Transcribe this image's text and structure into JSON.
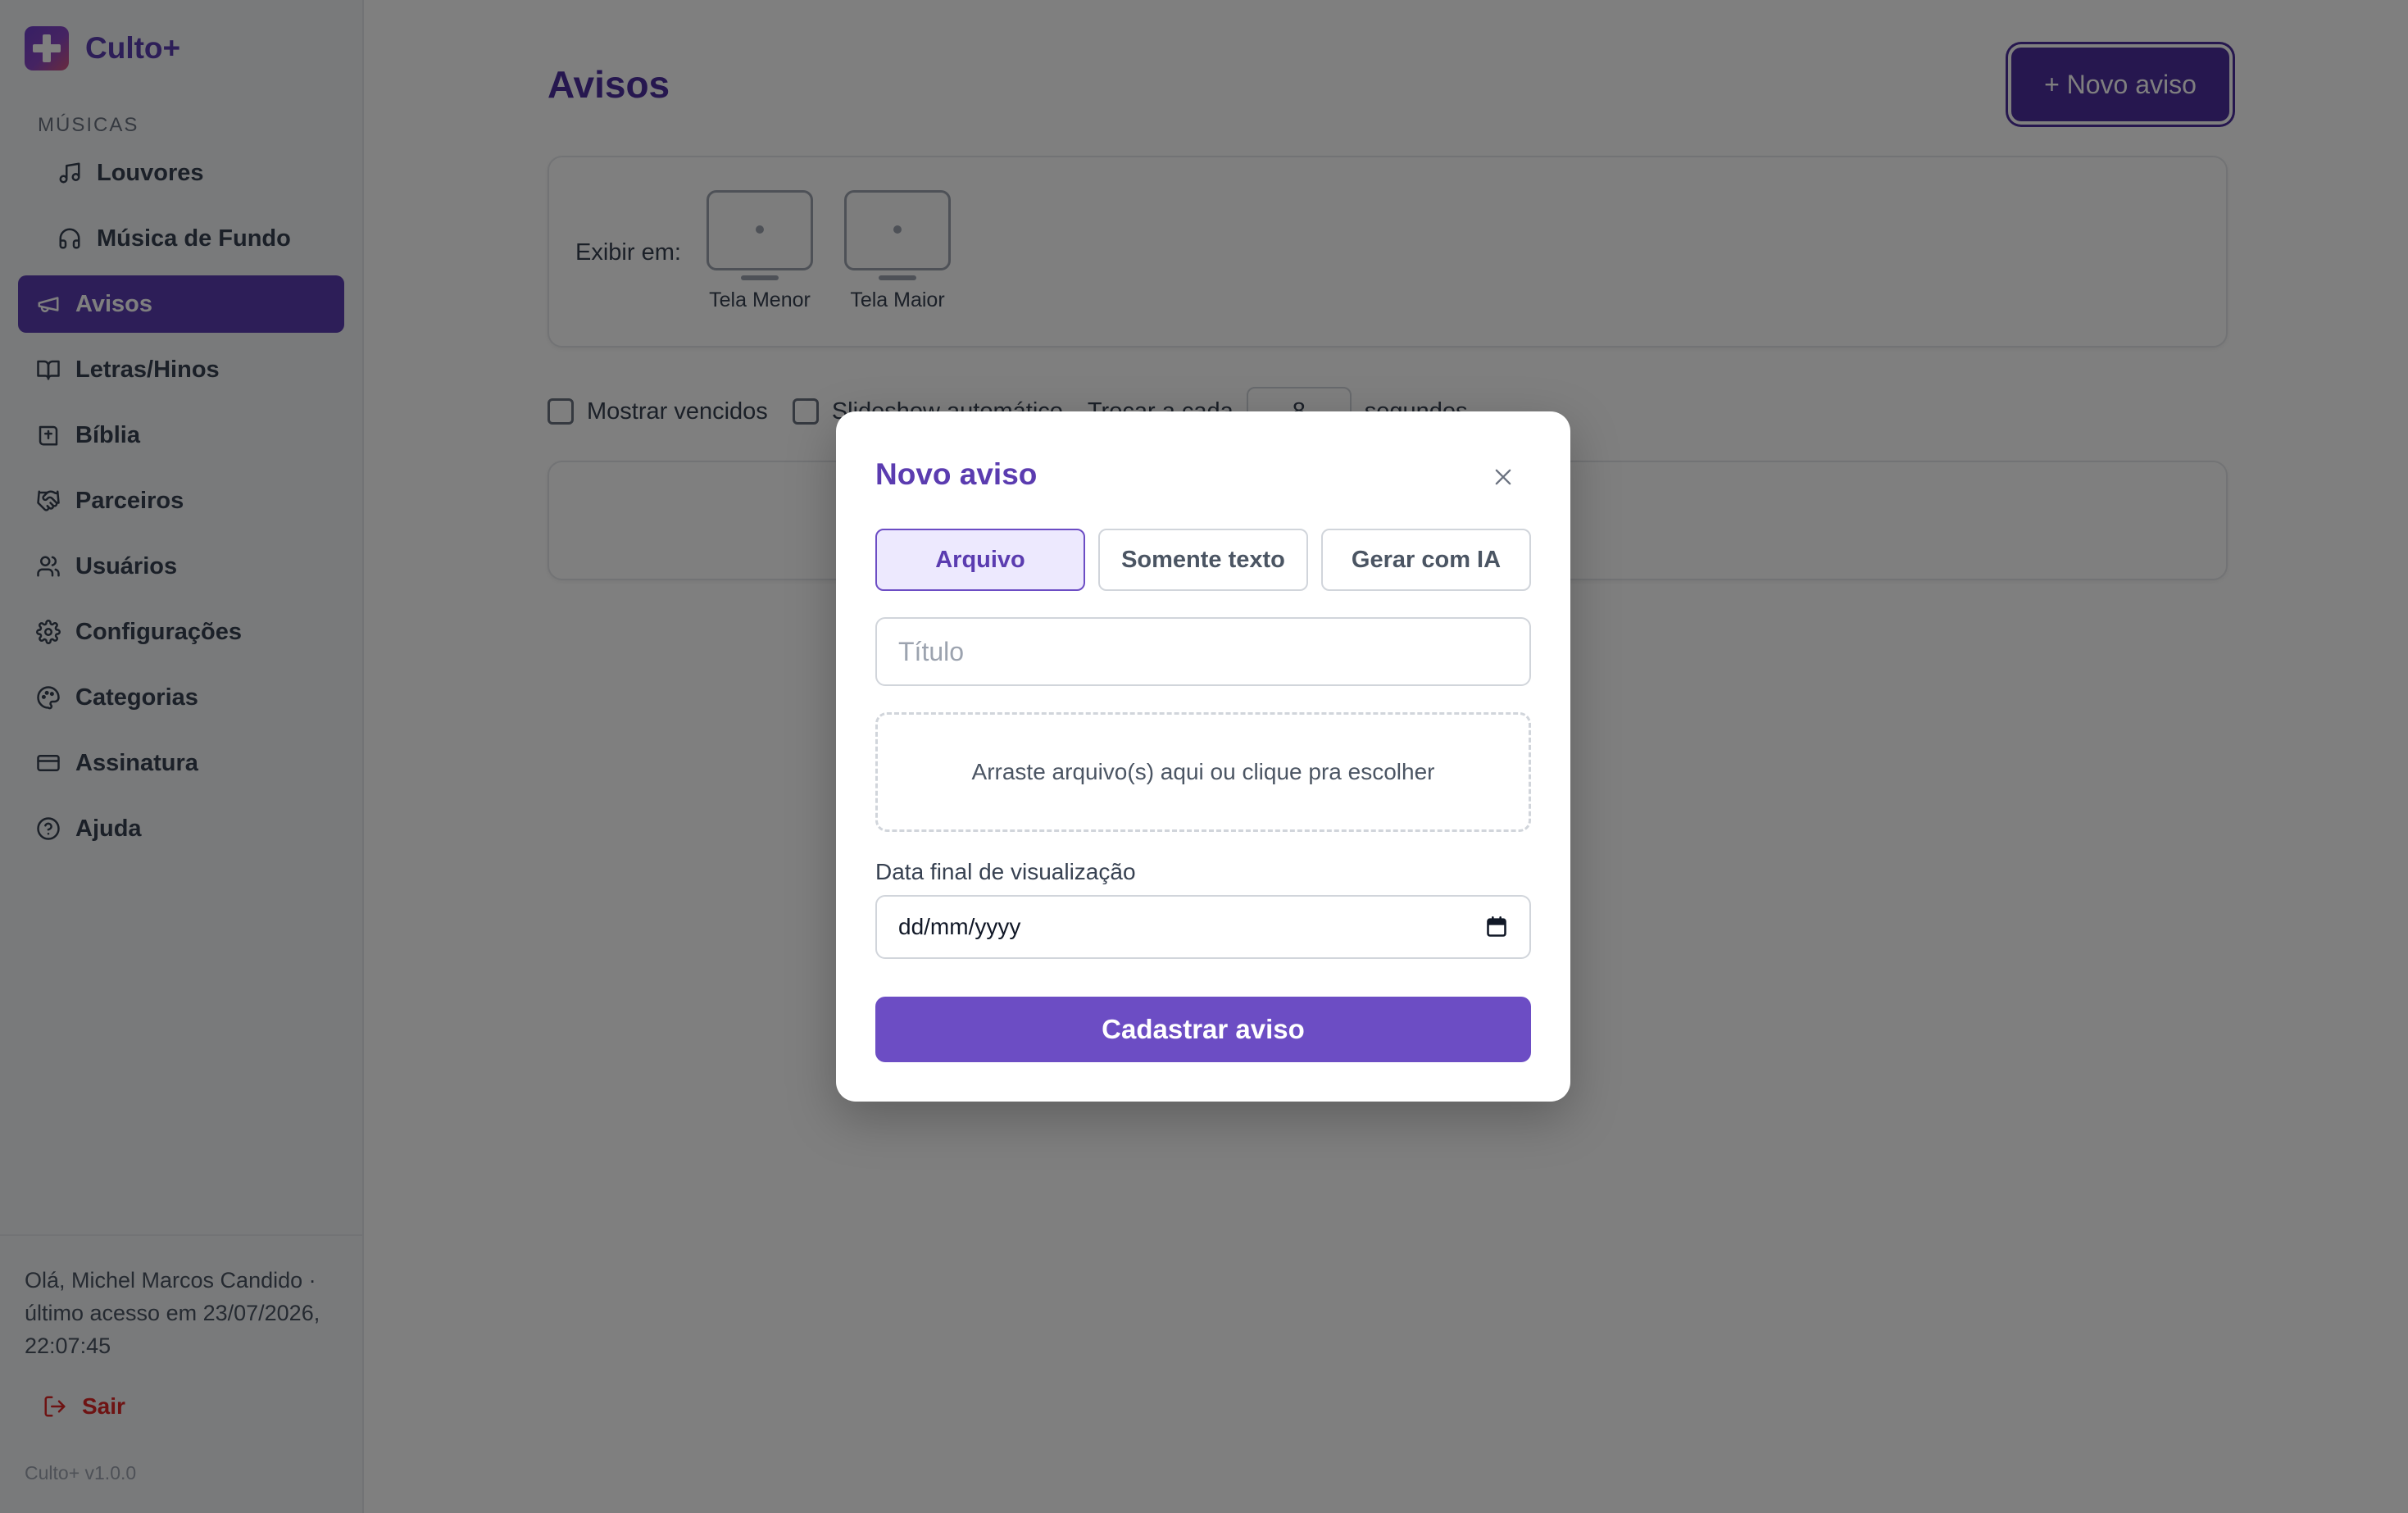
{
  "app": {
    "name": "Culto+",
    "version": "Culto+ v1.0.0"
  },
  "sidebar": {
    "section_label": "MÚSICAS",
    "items": [
      {
        "label": "Louvores",
        "icon": "music-note-icon"
      },
      {
        "label": "Música de Fundo",
        "icon": "headphones-icon"
      },
      {
        "label": "Avisos",
        "icon": "megaphone-icon",
        "active": true
      },
      {
        "label": "Letras/Hinos",
        "icon": "book-icon"
      },
      {
        "label": "Bíblia",
        "icon": "bible-icon"
      },
      {
        "label": "Parceiros",
        "icon": "handshake-icon"
      },
      {
        "label": "Usuários",
        "icon": "users-icon"
      },
      {
        "label": "Configurações",
        "icon": "gear-icon"
      },
      {
        "label": "Categorias",
        "icon": "palette-icon"
      },
      {
        "label": "Assinatura",
        "icon": "credit-card-icon"
      },
      {
        "label": "Ajuda",
        "icon": "help-circle-icon"
      }
    ],
    "user_info": "Olá, Michel Marcos Candido · último acesso em 23/07/2026, 22:07:45",
    "logout_label": "Sair"
  },
  "main": {
    "title": "Avisos",
    "new_button": "+ Novo aviso",
    "display": {
      "label": "Exibir em:",
      "options": [
        "Tela Menor",
        "Tela Maior"
      ]
    },
    "filters": {
      "show_expired": "Mostrar vencidos",
      "slideshow": "Slideshow automático",
      "change_every": "Trocar a cada",
      "seconds_value": "8",
      "seconds_label": "segundos"
    }
  },
  "modal": {
    "title": "Novo aviso",
    "tabs": [
      "Arquivo",
      "Somente texto",
      "Gerar com IA"
    ],
    "active_tab": "Arquivo",
    "title_placeholder": "Título",
    "dropzone_text": "Arraste arquivo(s) aqui ou clique pra escolher",
    "date_label": "Data final de visualização",
    "date_placeholder": "dd/mm/yyyy",
    "submit_label": "Cadastrar aviso"
  },
  "colors": {
    "accent": "#5b3cb0",
    "accent_button": "#6c4dc4",
    "logout": "#dc2626"
  }
}
